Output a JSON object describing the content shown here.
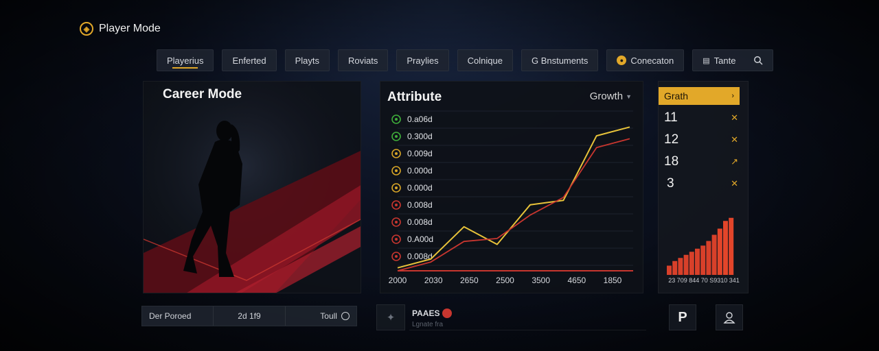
{
  "brand": {
    "title": "Player Mode",
    "icon": "badge-icon"
  },
  "nav": {
    "tabs": [
      {
        "label": "Playerius",
        "active": true
      },
      {
        "label": "Enferted"
      },
      {
        "label": "Playts"
      },
      {
        "label": "Roviats"
      },
      {
        "label": "Praylies"
      },
      {
        "label": "Colnique"
      },
      {
        "label": "G Bnstuments"
      },
      {
        "label": "Conecaton",
        "icon": "coin-icon"
      }
    ],
    "search_label": "Tante",
    "search_icon": "search-icon"
  },
  "career": {
    "title": "Career Mode"
  },
  "attribute": {
    "title": "Attribute",
    "dropdown": "Growth",
    "stats": [
      {
        "value": "0.a06d",
        "color": "#3fae3a"
      },
      {
        "value": "0.300d",
        "color": "#3fae3a"
      },
      {
        "value": "0.009d",
        "color": "#d6a427"
      },
      {
        "value": "0.000d",
        "color": "#d6a427"
      },
      {
        "value": "0.000d",
        "color": "#d6a427"
      },
      {
        "value": "0.008d",
        "color": "#c8362f"
      },
      {
        "value": "0.008d",
        "color": "#c8362f"
      },
      {
        "value": "0.A00d",
        "color": "#c8362f"
      },
      {
        "value": "0.008d",
        "color": "#c8362f"
      }
    ],
    "x_ticks": [
      "2000",
      "2030",
      "2650",
      "2500",
      "3500",
      "4650",
      "1850"
    ]
  },
  "chart_data": {
    "type": "line",
    "x": [
      "2000",
      "2030",
      "2650",
      "2500",
      "3500",
      "4650",
      "1850"
    ],
    "series": [
      {
        "color": "#e8c33a",
        "values": [
          2,
          8,
          30,
          18,
          45,
          48,
          92,
          98
        ]
      },
      {
        "color": "#c8362f",
        "values": [
          0,
          6,
          20,
          22,
          38,
          50,
          84,
          90
        ]
      }
    ],
    "ylim": [
      0,
      100
    ],
    "grid": true
  },
  "growth": {
    "header": "Grath",
    "rows": [
      "11",
      "12",
      "18",
      "3"
    ],
    "bars": [
      6,
      9,
      11,
      13,
      15,
      17,
      19,
      22,
      26,
      30,
      35,
      37
    ],
    "bar_label": "23 709 844 70 S9310 341"
  },
  "bottom": {
    "left": "Der Poroed",
    "center": "2d 1f9",
    "right": "Toull",
    "paaes_title": "PAAES",
    "paaes_sub": "Lgnate fra"
  },
  "colors": {
    "accent": "#e2a829",
    "red": "#c8362f",
    "line": "#e8c33a"
  }
}
